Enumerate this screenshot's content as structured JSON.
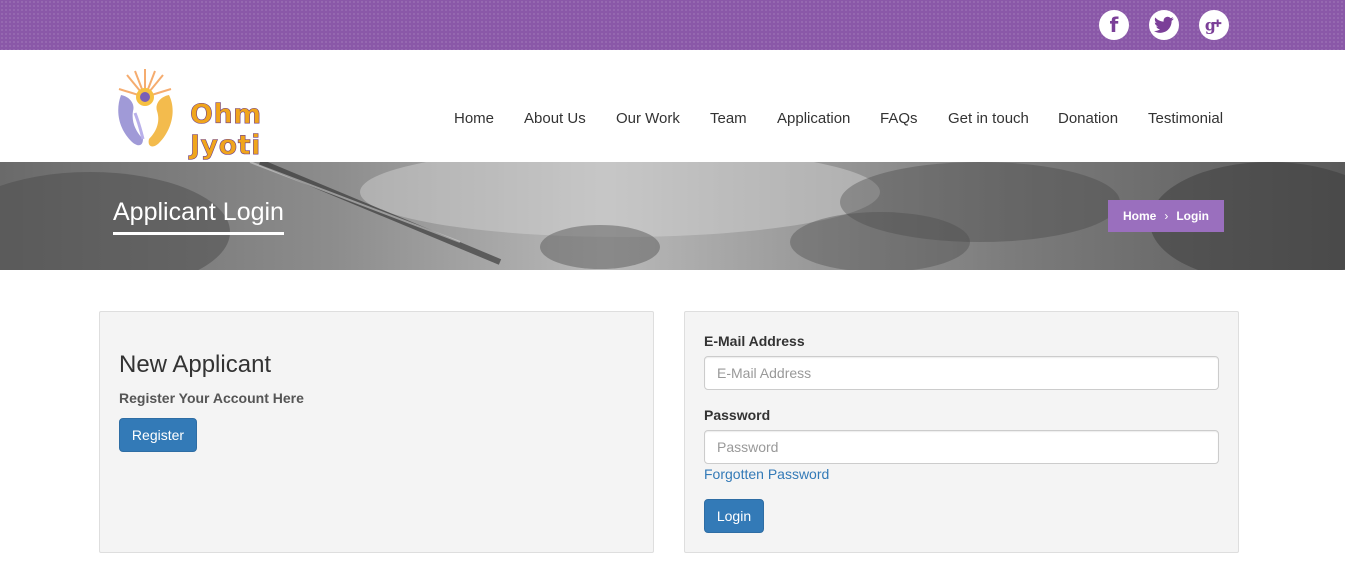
{
  "social": {
    "facebook_glyph": "f",
    "icons": [
      "facebook-icon",
      "twitter-icon",
      "google-plus-icon"
    ],
    "icon_color": "#7b3f98"
  },
  "brand": {
    "name": "Ohm Jyoti"
  },
  "nav": {
    "items": [
      "Home",
      "About Us",
      "Our Work",
      "Team",
      "Application",
      "FAQs",
      "Get in touch",
      "Donation",
      "Testimonial"
    ]
  },
  "banner": {
    "title": "Applicant Login",
    "breadcrumb": {
      "home": "Home",
      "current": "Login",
      "separator": "›"
    }
  },
  "new_applicant": {
    "title": "New Applicant",
    "subtitle": "Register Your Account Here",
    "register_label": "Register"
  },
  "login_form": {
    "email_label": "E-Mail Address",
    "email_placeholder": "E-Mail Address",
    "email_value": "",
    "password_label": "Password",
    "password_placeholder": "Password",
    "password_value": "",
    "forgot_label": "Forgotten Password",
    "login_label": "Login"
  },
  "colors": {
    "topbar": "#8a58a8",
    "breadcrumb_bg": "#9a6fbe",
    "primary_button": "#337ab7",
    "link": "#337ab7"
  }
}
